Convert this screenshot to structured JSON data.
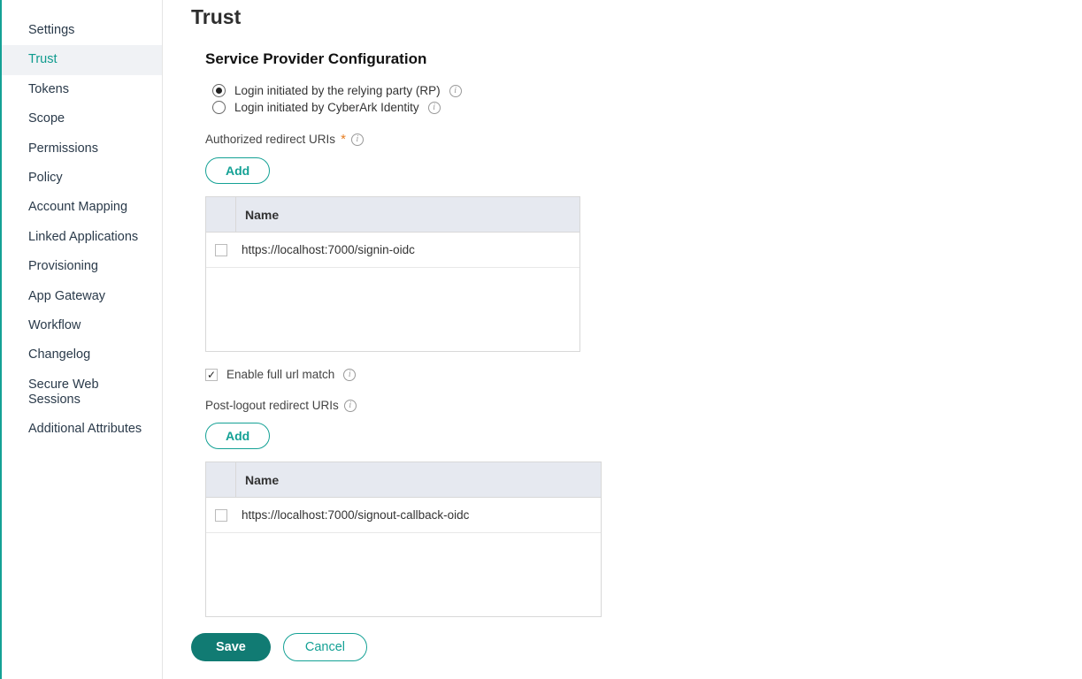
{
  "sidebar": {
    "items": [
      {
        "label": "Settings",
        "active": false
      },
      {
        "label": "Trust",
        "active": true
      },
      {
        "label": "Tokens",
        "active": false
      },
      {
        "label": "Scope",
        "active": false
      },
      {
        "label": "Permissions",
        "active": false
      },
      {
        "label": "Policy",
        "active": false
      },
      {
        "label": "Account Mapping",
        "active": false
      },
      {
        "label": "Linked Applications",
        "active": false
      },
      {
        "label": "Provisioning",
        "active": false
      },
      {
        "label": "App Gateway",
        "active": false
      },
      {
        "label": "Workflow",
        "active": false
      },
      {
        "label": "Changelog",
        "active": false
      },
      {
        "label": "Secure Web Sessions",
        "active": false
      },
      {
        "label": "Additional Attributes",
        "active": false
      }
    ]
  },
  "page": {
    "title": "Trust"
  },
  "spc": {
    "heading": "Service Provider Configuration",
    "login_options": {
      "rp": {
        "label": "Login initiated by the relying party (RP)",
        "checked": true
      },
      "idp": {
        "label": "Login initiated by CyberArk Identity",
        "checked": false
      }
    },
    "auth_redirect": {
      "label": "Authorized redirect URIs",
      "required": true,
      "add_label": "Add",
      "name_col": "Name",
      "rows": [
        {
          "uri": "https://localhost:7000/signin-oidc"
        }
      ]
    },
    "full_url_match": {
      "label": "Enable full url match",
      "checked": true
    },
    "post_logout": {
      "label": "Post-logout redirect URIs",
      "add_label": "Add",
      "name_col": "Name",
      "rows": [
        {
          "uri": "https://localhost:7000/signout-callback-oidc"
        }
      ]
    }
  },
  "footer": {
    "save": "Save",
    "cancel": "Cancel"
  }
}
